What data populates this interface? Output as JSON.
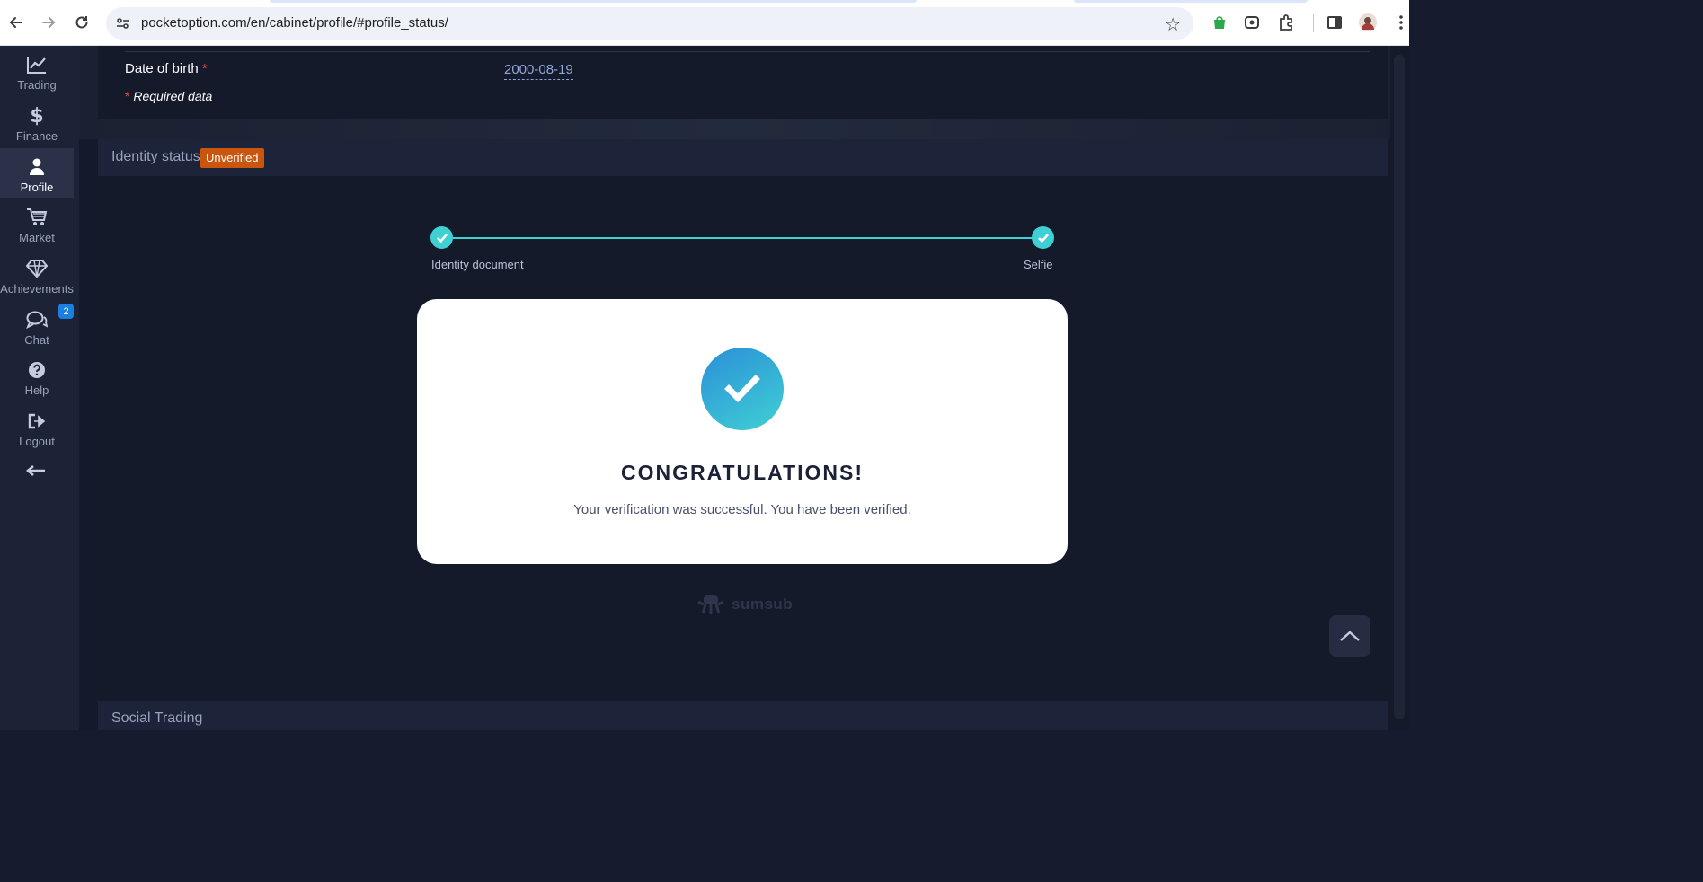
{
  "browser": {
    "url": "pocketoption.com/en/cabinet/profile/#profile_status/"
  },
  "sidebar": {
    "items": [
      {
        "label": "Trading",
        "icon": "chart-line-icon"
      },
      {
        "label": "Finance",
        "icon": "dollar-icon"
      },
      {
        "label": "Profile",
        "icon": "user-icon",
        "active": true
      },
      {
        "label": "Market",
        "icon": "cart-icon"
      },
      {
        "label": "Achievements",
        "icon": "diamond-icon"
      },
      {
        "label": "Chat",
        "icon": "chat-icon",
        "badge": "2"
      },
      {
        "label": "Help",
        "icon": "help-icon"
      },
      {
        "label": "Logout",
        "icon": "logout-icon"
      }
    ]
  },
  "personal": {
    "dob_label": "Date of birth",
    "dob_asterisk": "*",
    "dob_value": "2000-08-19",
    "required_asterisk": "*",
    "required_note": "Required data"
  },
  "identity": {
    "title": "Identity status",
    "status_badge": "Unverified",
    "steps": [
      {
        "label": "Identity document"
      },
      {
        "label": "Selfie"
      }
    ],
    "congrats_title": "CONGRATULATIONS!",
    "congrats_text": "Your verification was successful. You have been verified.",
    "provider": "sumsub"
  },
  "social": {
    "title": "Social Trading"
  },
  "colors": {
    "accent_teal": "#3fd0d4",
    "badge_orange": "#c9550f",
    "sidebar_bg": "#1d2336",
    "main_bg": "#151a2b"
  }
}
